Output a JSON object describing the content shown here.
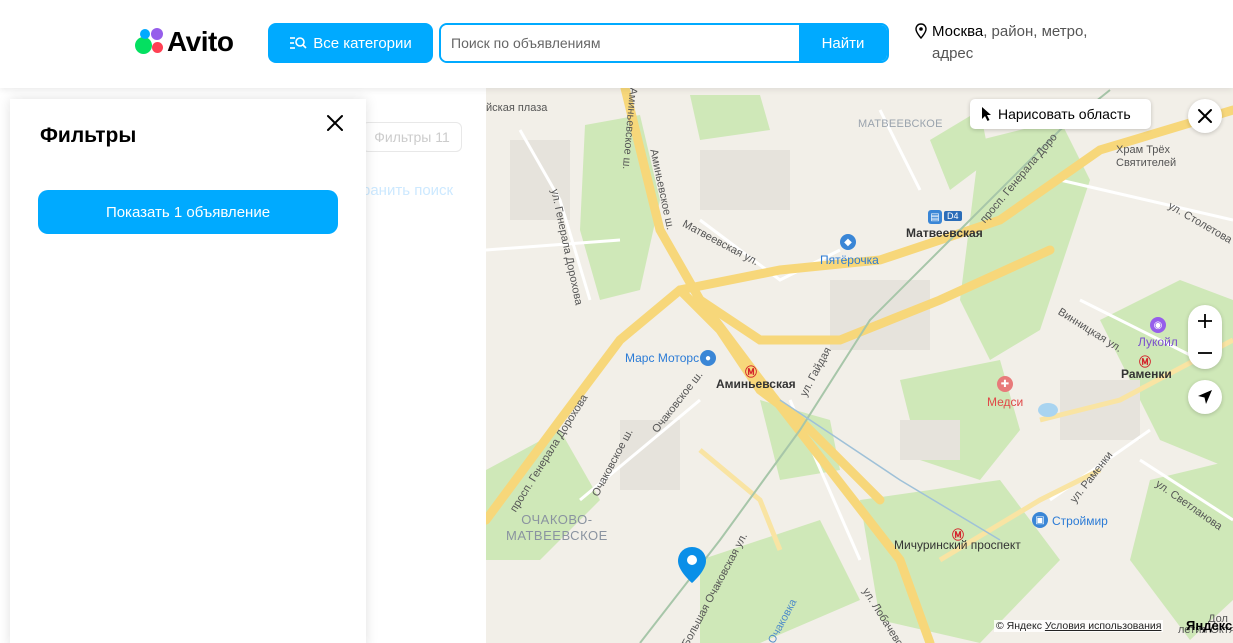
{
  "header": {
    "logo_text": "Avito",
    "categories_button": "Все категории",
    "search_placeholder": "Поиск по объявлениям",
    "search_button": "Найти",
    "location_city": "Москва",
    "location_rest": ", район, метро, адрес"
  },
  "background_panel": {
    "filters_label": "Фильтры",
    "filters_count": "11",
    "save_search": "ранить поиск"
  },
  "drawer": {
    "title": "Фильтры",
    "show_button": "Показать 1 объявление"
  },
  "map_controls": {
    "draw_area": "Нарисовать область",
    "zoom_in": "+",
    "zoom_out": "−"
  },
  "map_labels": {
    "plaza": "йская плаза",
    "matveevskoe_district": "МАТВЕЕВСКОЕ",
    "khram": "Храм Трёх Святителей",
    "prosp_gen_dor_top": "просп. Генерала Доро",
    "ul_stoletova": "ул. Столетова",
    "aminyevskoe_sh_1": "Аминьевское ш.",
    "aminyevskoe_sh_2": "Аминьевское ш.",
    "ul_gen_dorokhova": "ул. Генерала Дорохова",
    "matveevskaya_ul": "Матвеевская ул.",
    "matveevskaya_station": "Матвеевская",
    "d4": "D4",
    "pyaterochka": "Пятёрочка",
    "vinnitskaya": "Винницкая ул.",
    "lukoil": "Лукойл",
    "ramenki": "Раменки",
    "mars_motors": "Марс Моторс",
    "aminyevskaya": "Аминьевская",
    "ul_gaydaya": "ул. Гайдая",
    "medsi": "Медси",
    "ochakovskoe_sh_1": "Очаковское ш.",
    "ochakovskoe_sh_2": "Очаковское ш.",
    "prosp_gen_dorokhova": "просп. Генерала Дорохова",
    "ochakovo": "ОЧАКОВО-\nМАТВЕЕВСКОЕ",
    "ul_ramenki": "ул. Раменки",
    "ul_svetlanova": "ул. Светланова",
    "stroymir": "Строймир",
    "michurinsky": "Мичуринский проспект",
    "bolshaya_ochakovskaya": "Большая Очаковская ул.",
    "ul_lobachevskogo": "ул. Лобачевского",
    "ochakovka": "Очаковка",
    "dol": "Дол",
    "let_oktyabrya": "летия Октября"
  },
  "copyright": {
    "prefix": "© Яндекс",
    "terms": "Условия использования",
    "logo": "Яндекс"
  },
  "colors": {
    "accent": "#00aaff",
    "metro": "#d4232b",
    "road_major": "#f7d77a",
    "green": "#cfe8b8"
  }
}
